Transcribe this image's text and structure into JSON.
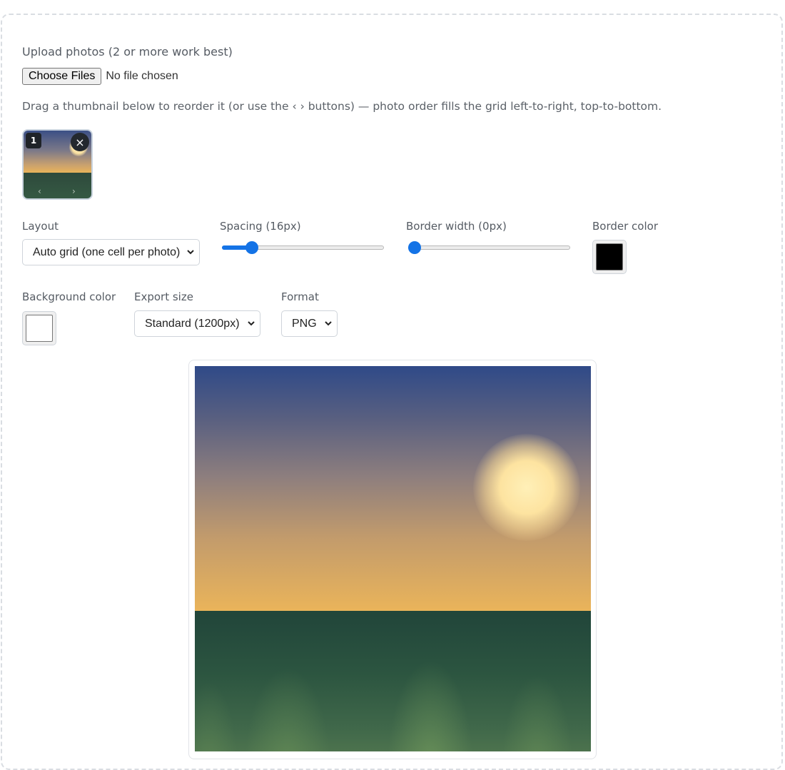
{
  "upload": {
    "label": "Upload photos (2 or more work best)",
    "button_label": "Choose Files",
    "status": "No file chosen"
  },
  "hint": "Drag a thumbnail below to reorder it (or use the ‹ › buttons) — photo order fills the grid left-to-right, top-to-bottom.",
  "thumbnails": [
    {
      "index": "1",
      "remove": "×",
      "move_left": "‹",
      "move_right": "›"
    }
  ],
  "controls": {
    "layout": {
      "label": "Layout",
      "value": "Auto grid (one cell per photo)"
    },
    "spacing": {
      "label": "Spacing (16px)",
      "value": 16,
      "min": 0,
      "max": 100
    },
    "border_width": {
      "label": "Border width (0px)",
      "value": 0,
      "min": 0,
      "max": 40
    },
    "border_color": {
      "label": "Border color",
      "value": "#000000"
    },
    "background_color": {
      "label": "Background color",
      "value": "#ffffff"
    },
    "export_size": {
      "label": "Export size",
      "value": "Standard (1200px)"
    },
    "format": {
      "label": "Format",
      "value": "PNG"
    }
  },
  "colors": {
    "accent": "#1473e6"
  }
}
